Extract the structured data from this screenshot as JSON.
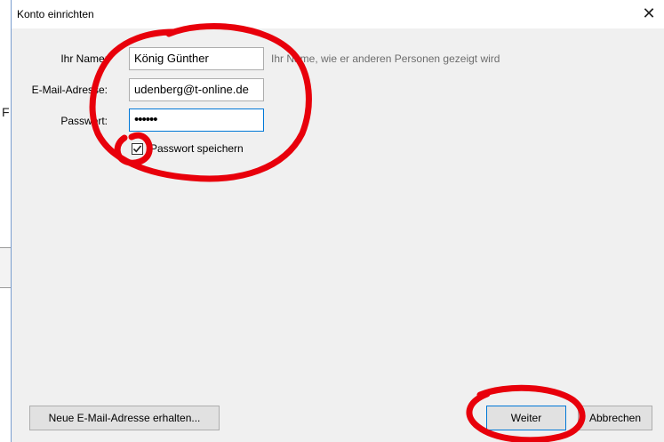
{
  "background": {
    "partial_letter": "F"
  },
  "dialog": {
    "title": "Konto einrichten",
    "close_glyph": "✕",
    "name_label": "Ihr Name:",
    "name_value": "König Günther",
    "name_hint": "Ihr Name, wie er anderen Personen gezeigt wird",
    "email_label": "E-Mail-Adresse:",
    "email_value": "udenberg@t-online.de",
    "password_label": "Passwort:",
    "password_value": "••••••",
    "remember_label": "Passwort speichern",
    "remember_checked": true,
    "new_address_button": "Neue E-Mail-Adresse erhalten...",
    "next_button": "Weiter",
    "cancel_button": "Abbrechen"
  },
  "annotation_color": "#e8000b"
}
